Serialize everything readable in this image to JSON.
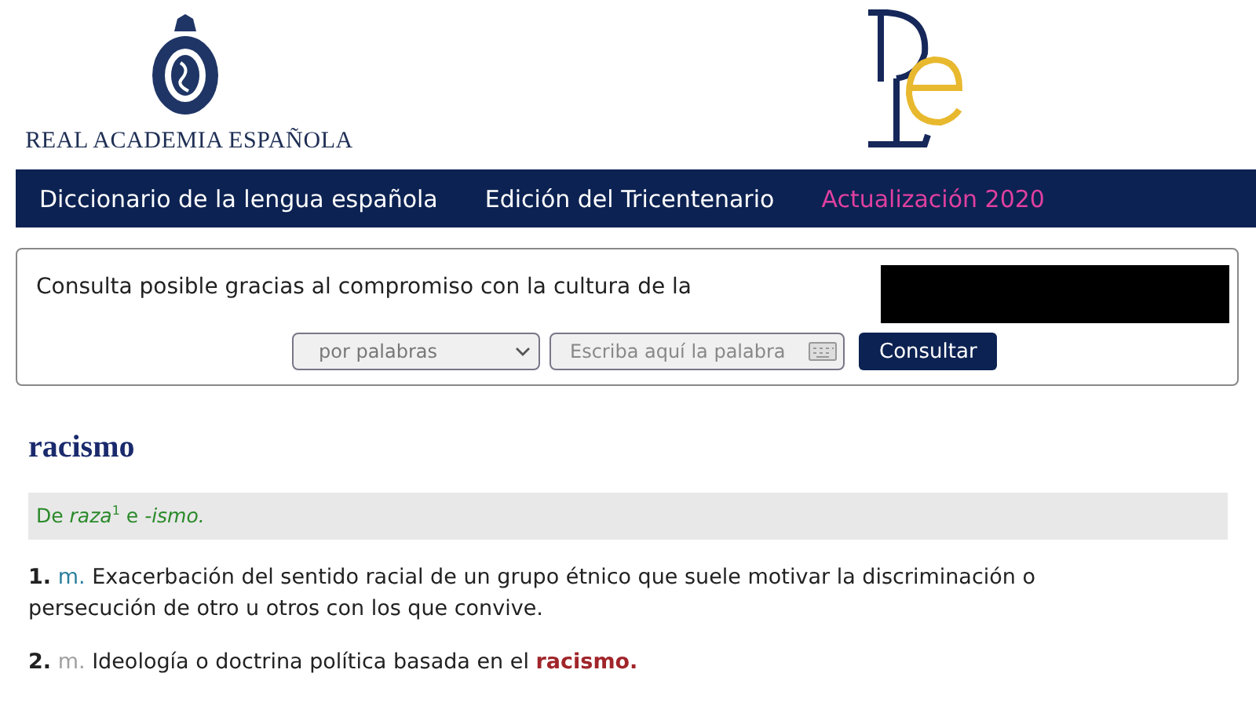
{
  "header": {
    "academy_name": "REAL ACADEMIA ESPAÑOLA"
  },
  "nav": [
    {
      "label": "Diccionario de la lengua española",
      "color": "#ffffff"
    },
    {
      "label": "Edición del Tricentenario",
      "color": "#ffffff"
    },
    {
      "label": "Actualización 2020",
      "color": "#e040a0"
    }
  ],
  "search": {
    "sponsor_text": "Consulta posible gracias al compromiso con la cultura de la",
    "mode": "por palabras",
    "placeholder": "Escriba aquí la palabra",
    "button": "Consultar"
  },
  "entry": {
    "headword": "racismo",
    "etymology": "De *raza*$^{1}$ e *-ismo.*",
    "definitions": [
      {
        "number": "1.",
        "abbr": "m.",
        "color": "#2a7f9e",
        "text": "Exacerbación del sentido racial de un grupo étnico que suele motivar la discriminación o persecución de otro u otros con los que convive."
      },
      {
        "number": "2.",
        "abbr": "m.",
        "color": "#a0a0a0",
        "text": "Ideología o doctrina política basada en el",
        "link": "racismo."
      }
    ]
  }
}
